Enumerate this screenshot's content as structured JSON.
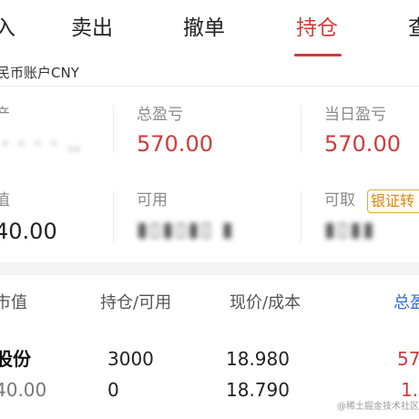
{
  "tabs": [
    {
      "label": "入",
      "active": false
    },
    {
      "label": "卖出",
      "active": false
    },
    {
      "label": "撤单",
      "active": false
    },
    {
      "label": "持仓",
      "active": true
    },
    {
      "label": "查",
      "active": false
    }
  ],
  "account": {
    "label": "民币账户CNY"
  },
  "summary": {
    "total_assets": {
      "label": "产"
    },
    "total_pnl": {
      "label": "总盈亏",
      "value": "570.00"
    },
    "today_pnl": {
      "label": "当日盈亏",
      "value": "570.00"
    },
    "market_value": {
      "label": "值",
      "value": "40.00"
    },
    "available": {
      "label": "可用"
    },
    "withdrawable": {
      "label": "可取"
    },
    "bank_transfer": {
      "label": "银证转"
    }
  },
  "table": {
    "headers": [
      "市值",
      "持仓/可用",
      "现价/成本",
      "总盈"
    ],
    "rows": [
      {
        "name": "股份",
        "market_value": "40.00",
        "position": "3000",
        "available": "0",
        "price": "18.980",
        "cost": "18.790",
        "pnl": "57",
        "pnl_ratio": "1."
      }
    ]
  },
  "watermark": "@稀土掘金技术社区",
  "colors": {
    "accent_red": "#d13b3b",
    "accent_blue": "#2f6fd6",
    "accent_orange": "#d98a14"
  }
}
